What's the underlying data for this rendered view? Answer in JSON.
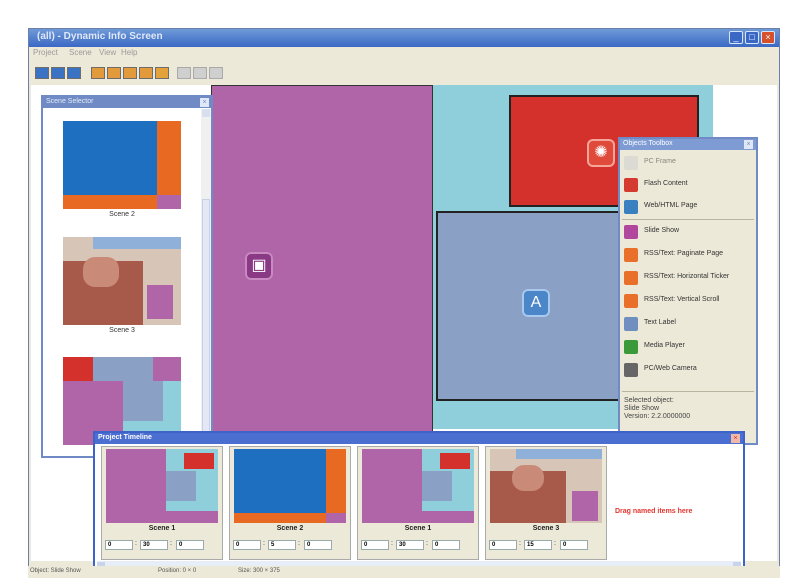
{
  "window": {
    "title": "(all) - Dynamic Info Screen",
    "menu": [
      "Project",
      "Scene",
      "View",
      "Help"
    ],
    "controls": [
      "_",
      "□",
      "×"
    ]
  },
  "canvas": {
    "icon_purple": "▣",
    "icon_red": "✺",
    "icon_blue": "A"
  },
  "scene_selector": {
    "title": "Scene Selector",
    "scenes": [
      "Scene 2",
      "Scene 3"
    ]
  },
  "objects_toolbox": {
    "title": "Objects Toolbox",
    "items": [
      {
        "label": "PC Frame",
        "color": "#cfcfcf",
        "icon": "frame-icon"
      },
      {
        "label": "Flash Content",
        "color": "#d43a2f",
        "icon": "flash-icon"
      },
      {
        "label": "Web/HTML Page",
        "color": "#3a7fc0",
        "icon": "web-icon"
      },
      {
        "label": "Slide Show",
        "color": "#b0479c",
        "icon": "slideshow-icon"
      },
      {
        "label": "RSS/Text: Paginate Page",
        "color": "#e8702a",
        "icon": "rss-icon"
      },
      {
        "label": "RSS/Text: Horizontal Ticker",
        "color": "#e8702a",
        "icon": "rss-icon"
      },
      {
        "label": "RSS/Text: Vertical Scroll",
        "color": "#e8702a",
        "icon": "rss-icon"
      },
      {
        "label": "Text Label",
        "color": "#6f8fc0",
        "icon": "text-label-icon"
      },
      {
        "label": "Media Player",
        "color": "#3a9a3a",
        "icon": "media-player-icon"
      },
      {
        "label": "PC/Web Camera",
        "color": "#666666",
        "icon": "camera-icon"
      }
    ],
    "selected_label": "Selected object:",
    "selected_name": "Slide Show",
    "selected_version": "Version: 2.2.0000000"
  },
  "timeline": {
    "title": "Project Timeline",
    "frames": [
      {
        "name": "Scene 1",
        "min": "0",
        "sec": "30",
        "frac": "0"
      },
      {
        "name": "Scene 2",
        "min": "0",
        "sec": "5",
        "frac": "0"
      },
      {
        "name": "Scene 1",
        "min": "0",
        "sec": "30",
        "frac": "0"
      },
      {
        "name": "Scene 3",
        "min": "0",
        "sec": "15",
        "frac": "0"
      }
    ],
    "drop_hint": "Drag named items here"
  },
  "status": {
    "object": "Object: Slide Show",
    "position": "Position: 0 × 0",
    "size": "Size: 300 × 375"
  }
}
